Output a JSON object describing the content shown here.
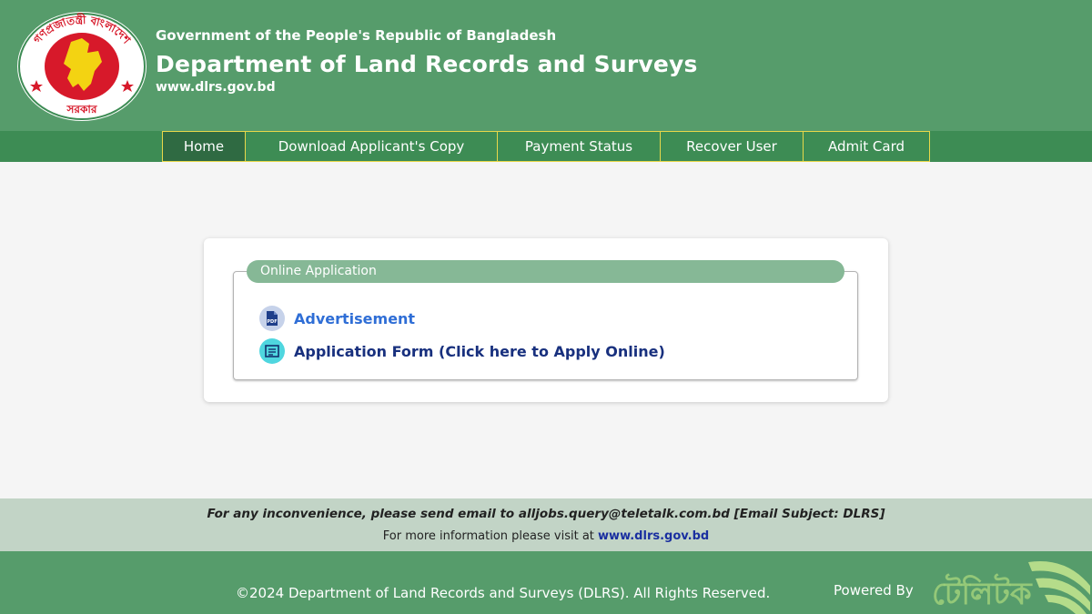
{
  "header": {
    "gov_title": "Government of the People's Republic of Bangladesh",
    "dept_title": "Department of Land Records and Surveys",
    "website": "www.dlrs.gov.bd",
    "logo": {
      "top_text": "গণপ্রজাতন্ত্রী বাংলাদেশ",
      "bottom_text": "সরকার"
    }
  },
  "nav": {
    "items": [
      {
        "label": "Home",
        "active": true
      },
      {
        "label": "Download Applicant's Copy",
        "active": false
      },
      {
        "label": "Payment Status",
        "active": false
      },
      {
        "label": "Recover User",
        "active": false
      },
      {
        "label": "Admit Card",
        "active": false
      }
    ]
  },
  "main": {
    "section_title": "Online Application",
    "links": [
      {
        "label": "Advertisement",
        "icon": "pdf-icon",
        "icon_text": "PDF"
      },
      {
        "label": "Application Form (Click here to Apply Online)",
        "icon": "form-icon"
      }
    ]
  },
  "info": {
    "contact_line": "For any inconvenience, please send email to alljobs.query@teletalk.com.bd [Email Subject: DLRS]",
    "visit_prefix": "For more information please visit at",
    "visit_link": "www.dlrs.gov.bd"
  },
  "footer": {
    "copyright": "©2024 Department of Land Records and Surveys (DLRS). All Rights Reserved.",
    "powered_by": "Powered By",
    "brand_text": "টেলিটক"
  },
  "colors": {
    "header_green": "#569c6b",
    "nav_green": "#3d8c54",
    "nav_active": "#2f6a42",
    "nav_border": "#e8d84a",
    "legend_green": "#86b896",
    "info_bg": "#c2d4c6",
    "link_blue": "#2f6ed6",
    "link_navy": "#18307e"
  }
}
